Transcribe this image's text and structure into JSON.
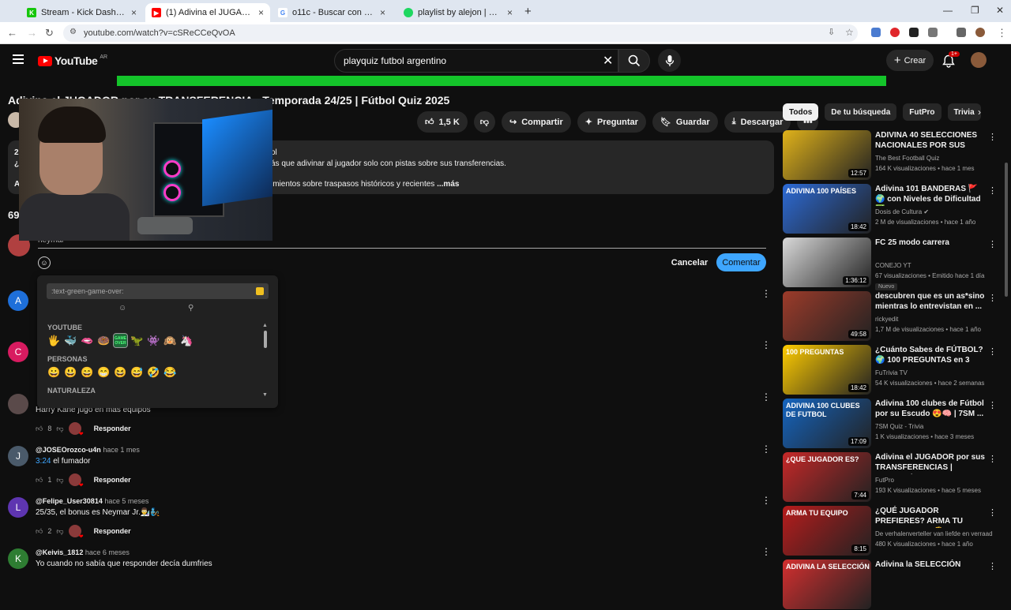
{
  "browser": {
    "tabs": [
      {
        "title": "Stream - Kick Dashboard",
        "favicon": "K"
      },
      {
        "title": "(1) Adivina el JUGADOR por su",
        "favicon": "▶"
      },
      {
        "title": "o11c - Buscar con Google",
        "favicon": "G"
      },
      {
        "title": "playlist by alejon | Spotify",
        "favicon": "●"
      }
    ],
    "url": "youtube.com/watch?v=cSReCCeQvOA"
  },
  "youtube": {
    "logo_word": "YouTube",
    "region": "AR",
    "search_query": "playquiz futbol argentino",
    "create_label": "Crear",
    "notif_count": "1+"
  },
  "video": {
    "title": "Adivina el JUGADOR por su TRANSFERENCIA - Temporada 24/25 | Fútbol Quiz 2025",
    "likes": "1,5 K",
    "share": "Compartir",
    "ask": "Preguntar",
    "save": "Guardar",
    "download": "Descargar",
    "desc_left": [
      "2",
      "¿",
      "A"
    ],
    "desc_frag1": "ol",
    "desc_line1": "ás que adivinar al jugador solo con pistas sobre sus transferencias.",
    "desc_line2": "imientos sobre traspasos históricos y recientes",
    "desc_more": "...más",
    "comment_count": "69"
  },
  "reply": {
    "text": "neymar",
    "cancel": "Cancelar",
    "submit": "Comentar"
  },
  "emoji_picker": {
    "search_text": ":text-green-game-over:",
    "section_youtube": "YOUTUBE",
    "section_personas": "PERSONAS",
    "section_naturaleza": "NATURALEZA",
    "youtube_emojis": [
      "🖐",
      "🐳",
      "🫦",
      "🍩",
      "GAME OVER",
      "🦖",
      "👾",
      "🙉",
      "🦄"
    ],
    "people_emojis": [
      "😀",
      "😃",
      "😄",
      "😁",
      "😆",
      "😅",
      "🤣",
      "😂"
    ]
  },
  "comments": [
    {
      "user": "@JOSEOrozco-u4n",
      "when": "hace 1 mes",
      "ts": "3:24",
      "text": " el fumador",
      "likes": "1",
      "avatar": "J",
      "color": "#4a5a6a"
    },
    {
      "user": "@Felipe_User30814",
      "when": "hace 5 meses",
      "ts": "",
      "text": "25/35, el bonus es Neymar Jr.👨‍🔬🧞",
      "likes": "2",
      "avatar": "L",
      "color": "#5e35b1"
    },
    {
      "user": "@Keivis_1812",
      "when": "hace 6 meses",
      "ts": "",
      "text": "Yo cuando no sabía que responder decía dumfries",
      "likes": "",
      "avatar": "K",
      "color": "#2e7d32"
    }
  ],
  "comment_partial": {
    "text": "Harry Kane jugo en más equipos",
    "likes": "8"
  },
  "reply_label": "Responder",
  "side_avatars": [
    "A",
    "C"
  ],
  "chips": [
    "Todos",
    "De tu búsqueda",
    "FutPro",
    "Trivia"
  ],
  "recommendations": [
    {
      "title": "ADIVINA 40 SELECCIONES NACIONALES POR SUS CLUBE...",
      "channel": "The Best Football Quiz",
      "meta": "164 K visualizaciones • hace 1 mes",
      "duration": "12:57",
      "color": "#e0b21a",
      "thumb_text": ""
    },
    {
      "title": "Adivina 101 BANDERAS 🚩🌍 con Niveles de Dificultad ✅-...",
      "channel": "Dosis de Cultura ✔",
      "meta": "2 M de visualizaciones • hace 1 año",
      "duration": "18:42",
      "color": "#2d6bd6",
      "thumb_text": "ADIVINA 100 PAÍSES"
    },
    {
      "title": "FC 25 modo carrera",
      "channel": "CONEJO YT",
      "meta": "67 visualizaciones • Emitido hace 1 día",
      "duration": "1:36:12",
      "color": "#d9d9d9",
      "thumb_text": "",
      "badge": "Nuevo"
    },
    {
      "title": "descubren que es un as*sino mientras lo entrevistan en ...",
      "channel": "rickyedit",
      "meta": "1,7 M de visualizaciones • hace 1 año",
      "duration": "49:58",
      "color": "#9c3b2a",
      "thumb_text": ""
    },
    {
      "title": "¿Cuánto Sabes de FÚTBOL? 🌍 100 PREGUNTAS en 3 NIVELE...",
      "channel": "FuTrivia TV",
      "meta": "54 K visualizaciones • hace 2 semanas",
      "duration": "18:42",
      "color": "#ffcc00",
      "thumb_text": "100 PREGUNTAS"
    },
    {
      "title": "Adivina 100 clubes de Fútbol por su Escudo 😍🧠 | 7SM ...",
      "channel": "7SM Quiz - Trivia",
      "meta": "1 K visualizaciones • hace 3 meses",
      "duration": "17:09",
      "color": "#1565c0",
      "thumb_text": "ADIVINA 100 CLUBES DE FUTBOL"
    },
    {
      "title": "Adivina el JUGADOR por sus TRANSFERENCIAS | Temporad...",
      "channel": "FutPro",
      "meta": "193 K visualizaciones • hace 5 meses",
      "duration": "7:44",
      "color": "#c62828",
      "thumb_text": "¿QUE JUGADOR ES?"
    },
    {
      "title": "¿QUÉ JUGADOR PREFIERES? ARMA TU EQUIPO IDEAL 🤔 ...",
      "channel": "De verhalenverteller van liefde en verraad",
      "meta": "480 K visualizaciones • hace 1 año",
      "duration": "8:15",
      "color": "#b71c1c",
      "thumb_text": "ARMA TU EQUIPO"
    },
    {
      "title": "Adivina la SELECCIÓN",
      "channel": "",
      "meta": "",
      "duration": "",
      "color": "#d32f2f",
      "thumb_text": "ADIVINA LA SELECCIÓN"
    }
  ]
}
